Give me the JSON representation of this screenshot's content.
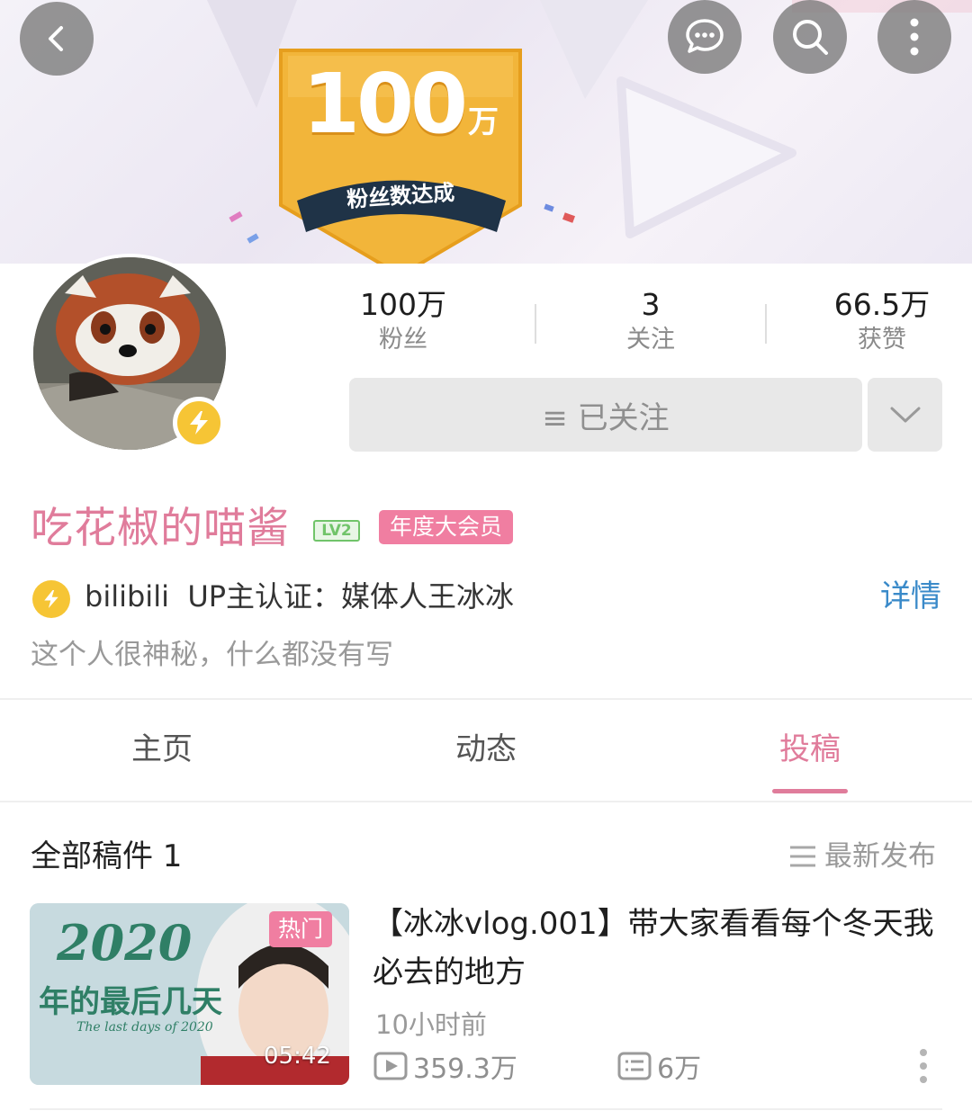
{
  "banner": {
    "badge_number": "100",
    "badge_unit": "万",
    "badge_ribbon": "粉丝数达成"
  },
  "stats": [
    {
      "value": "100万",
      "label": "粉丝"
    },
    {
      "value": "3",
      "label": "关注"
    },
    {
      "value": "66.5万",
      "label": "获赞"
    }
  ],
  "follow": {
    "label": "≡ 已关注"
  },
  "profile": {
    "username": "吃花椒的喵酱",
    "level": "LV2",
    "vip": "年度大会员",
    "certification": "bilibili  UP主认证：媒体人王冰冰",
    "detail_link": "详情",
    "signature": "这个人很神秘，什么都没有写"
  },
  "tabs": [
    {
      "label": "主页"
    },
    {
      "label": "动态"
    },
    {
      "label": "投稿"
    }
  ],
  "list": {
    "title": "全部稿件 1",
    "sort_label": "最新发布"
  },
  "video": {
    "thumb_text": "2020",
    "thumb_sub": "年的最后几天",
    "thumb_eng": "The last days of 2020",
    "hot_tag": "热门",
    "duration": "05:42",
    "title": "【冰冰vlog.001】带大家看看每个冬天我必去的地方",
    "time": "10小时前",
    "plays": "359.3万",
    "danmaku": "6万"
  },
  "colors": {
    "accent_pink": "#e07c9b",
    "link_blue": "#3a8ac9",
    "badge_gold": "#f2b53a"
  }
}
